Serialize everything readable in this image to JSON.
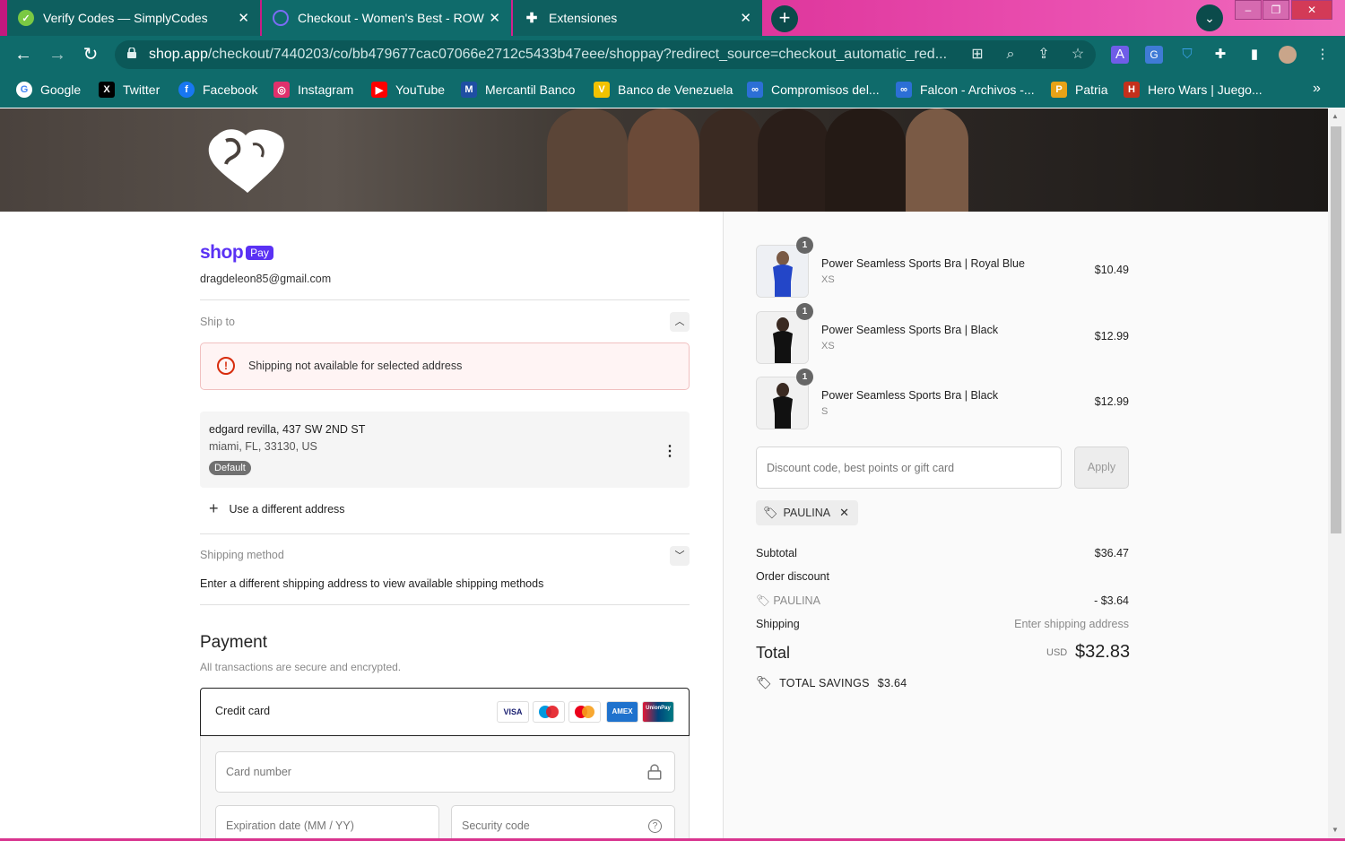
{
  "browser": {
    "tabs": [
      {
        "title": "Verify Codes — SimplyCodes",
        "icon": "checkmark-circle-icon"
      },
      {
        "title": "Checkout - Women's Best - ROW",
        "icon": "loading-spinner-icon"
      },
      {
        "title": "Extensiones",
        "icon": "puzzle-icon"
      }
    ],
    "url_host": "shop.app",
    "url_path": "/checkout/7440203/co/bb479677cac07066e2712c5433b47eee/shoppay?redirect_source=checkout_automatic_red...",
    "bookmarks": [
      {
        "label": "Google",
        "icon": "google-icon",
        "color": "#4285f4"
      },
      {
        "label": "Twitter",
        "icon": "x-icon",
        "color": "#000000"
      },
      {
        "label": "Facebook",
        "icon": "facebook-icon",
        "color": "#1877f2"
      },
      {
        "label": "Instagram",
        "icon": "instagram-icon",
        "color": "#e1306c"
      },
      {
        "label": "YouTube",
        "icon": "youtube-icon",
        "color": "#ff0000"
      },
      {
        "label": "Mercantil Banco",
        "icon": "mercantil-icon",
        "color": "#1f4fa3"
      },
      {
        "label": "Banco de Venezuela",
        "icon": "bdv-icon",
        "color": "#f2c200"
      },
      {
        "label": "Compromisos del...",
        "icon": "link-icon",
        "color": "#2c6fd6"
      },
      {
        "label": "Falcon - Archivos -...",
        "icon": "link-icon",
        "color": "#2c6fd6"
      },
      {
        "label": "Patria",
        "icon": "patria-icon",
        "color": "#e8a317"
      },
      {
        "label": "Hero Wars | Juego...",
        "icon": "hero-wars-icon",
        "color": "#c4301c"
      }
    ]
  },
  "checkout": {
    "brand": "shop",
    "brand_badge": "Pay",
    "email": "dragdeleon85@gmail.com",
    "ship_to_label": "Ship to",
    "alert_text": "Shipping not available for selected address",
    "address_line1": "edgard revilla, 437 SW 2ND ST",
    "address_line2": "miami, FL, 33130, US",
    "address_badge": "Default",
    "use_different_address": "Use a different address",
    "shipping_method_label": "Shipping method",
    "shipping_method_msg": "Enter a different shipping address to view available shipping methods",
    "payment_title": "Payment",
    "payment_subtitle": "All transactions are secure and encrypted.",
    "credit_card_label": "Credit card",
    "card_brands": [
      "VISA",
      "Maestro",
      "Mastercard",
      "AMEX",
      "UnionPay"
    ],
    "card_number_placeholder": "Card number",
    "expiry_placeholder": "Expiration date (MM / YY)",
    "security_placeholder": "Security code"
  },
  "summary": {
    "items": [
      {
        "name": "Power Seamless Sports Bra | Royal Blue",
        "variant": "XS",
        "price": "$10.49",
        "qty": "1"
      },
      {
        "name": "Power Seamless Sports Bra | Black",
        "variant": "XS",
        "price": "$12.99",
        "qty": "1"
      },
      {
        "name": "Power Seamless Sports Bra | Black",
        "variant": "S",
        "price": "$12.99",
        "qty": "1"
      }
    ],
    "discount_placeholder": "Discount code, best points or gift card",
    "apply_label": "Apply",
    "applied_code": "PAULINA",
    "subtotal_label": "Subtotal",
    "subtotal_value": "$36.47",
    "order_discount_label": "Order discount",
    "discount_code": "PAULINA",
    "discount_value": "- $3.64",
    "shipping_label": "Shipping",
    "shipping_value": "Enter shipping address",
    "total_label": "Total",
    "currency": "USD",
    "total_value": "$32.83",
    "savings_label": "TOTAL SAVINGS",
    "savings_value": "$3.64"
  },
  "colors": {
    "shop_purple": "#5a31f4",
    "browser_teal": "#0f6b6b",
    "error_red": "#d72c0d"
  }
}
